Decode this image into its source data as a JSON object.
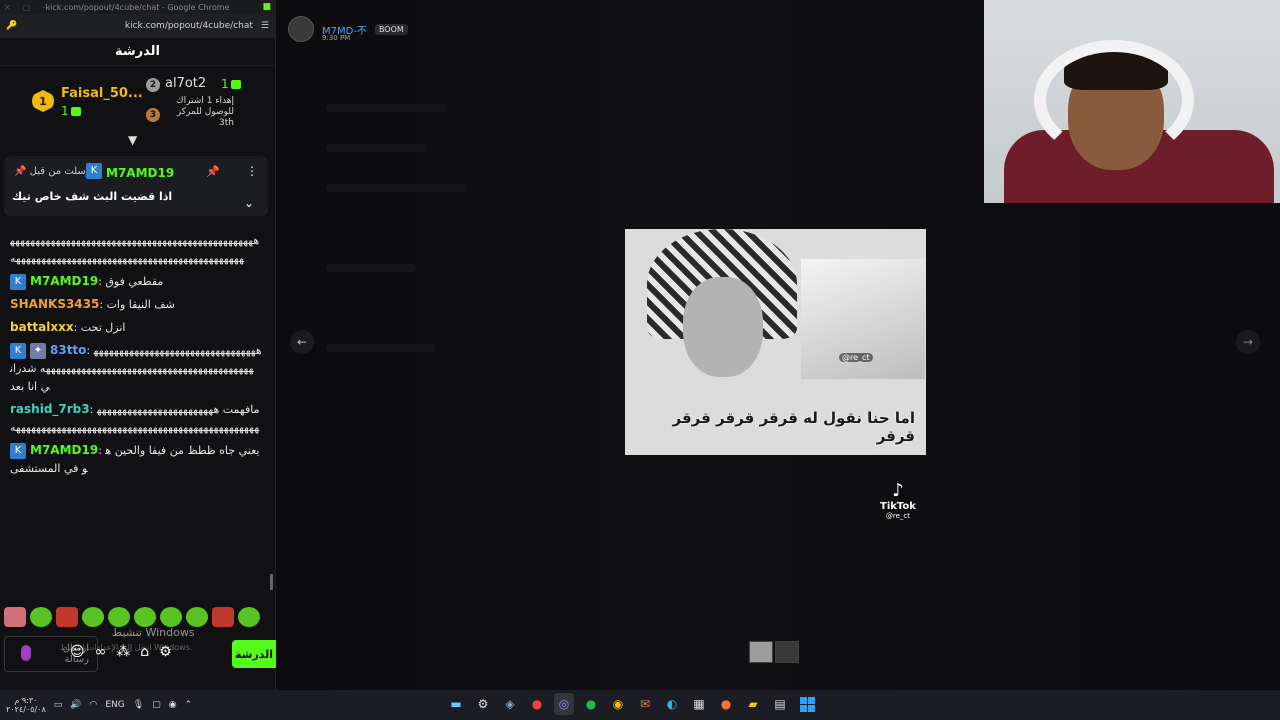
{
  "browser": {
    "window_title": "kick.com/popout/4cube/chat - Google Chrome",
    "url": "kick.com/popout/4cube/chat"
  },
  "chat": {
    "header": "الدرشة",
    "leaderboard": [
      {
        "rank": "1",
        "name": "Faisal_50...",
        "count": "1"
      },
      {
        "rank": "2",
        "name": "al7ot2",
        "count": "1"
      },
      {
        "rank": "3",
        "label": "إهداء 1 اشتراك للوصول للمركز",
        "place": "3th"
      }
    ],
    "pinned": {
      "sent_label": "أرسلت من قبل",
      "user": "M7AMD19",
      "message": "اذا قضيت البث شف خاص تيك"
    },
    "messages": [
      {
        "user": "",
        "text": "ههههههههههههههههههههههههههههههههههههههههههههههههههههههههههههههههههههههههههههههههههههههههههههههه",
        "color": "#e8e8e8",
        "badge": ""
      },
      {
        "user": "M7AMD19",
        "text": "مقطعي فوق",
        "color": "#53fc18",
        "badge": "kick"
      },
      {
        "user": "SHANKS3435",
        "text": "شف النيقا وات",
        "color": "#f0a030",
        "badge": ""
      },
      {
        "user": "battalxxx",
        "text": "انزل تحت",
        "color": "#f0d040",
        "badge": ""
      },
      {
        "user": "83tto",
        "text": "ههههههههههههههههههههههههههههههههههههههههههههههههههههههههههههههههههههههههههه شدراني انا بعد",
        "color": "#5aa0ff",
        "badge": "kick-gift"
      },
      {
        "user": "rashid_7rb3",
        "text": "مافهمت ههههههههههههههههههههههههههههههههههههههههههههههههههههههههههههههههههههههههه",
        "color": "#40d0c0",
        "badge": ""
      },
      {
        "user": "M7AMD19",
        "text": "يعني جاه ظطظ من فيفا والحين هو في المستشفى",
        "color": "#53fc18",
        "badge": "kick"
      }
    ],
    "input_placeholder": "ارسال رسالة",
    "send_label": "الدرشة",
    "windows_watermark": "تنشيط Windows",
    "windows_watermark_sub": "انتقل إلى الإعدادات لتنشيط Windows."
  },
  "stage": {
    "poster_name": "M7MD-不",
    "poster_tag": "BOOM",
    "poster_time": "9:30 PM",
    "media_caption": "اما حنا نقول له قرقر قرقر قرقر قرقر",
    "media_handle": "@re_ct",
    "tiktok_word": "TikTok",
    "tiktok_handle": "@re_ct"
  },
  "taskbar": {
    "time": "٩:٣٠ م",
    "date": "٢٠٢٤/٠٥/٠٨",
    "lang": "ENG",
    "apps": [
      "terminal-icon",
      "settings-icon",
      "steam-icon",
      "app-icon",
      "discord-icon",
      "spotify-icon",
      "chrome-icon",
      "mail-icon",
      "edge-icon",
      "calendar-icon",
      "firefox-icon",
      "explorer-icon",
      "window-icon",
      "start-icon"
    ]
  }
}
